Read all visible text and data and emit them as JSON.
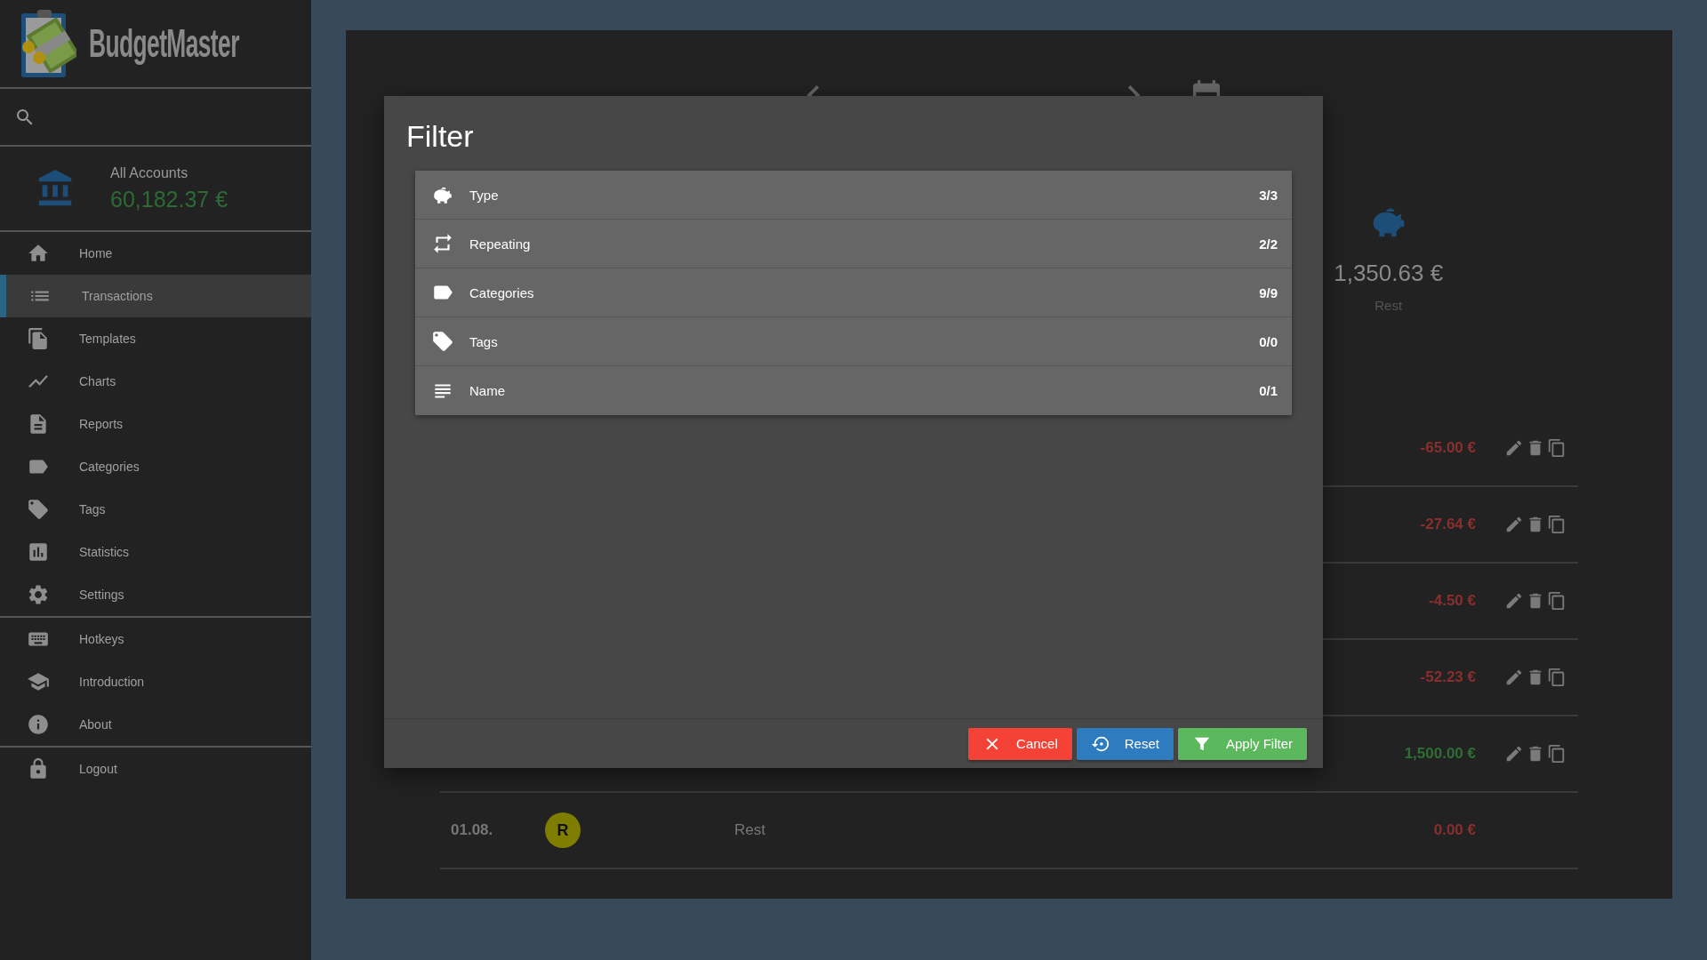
{
  "sidebar": {
    "app_name": "BudgetMaster",
    "account": {
      "name": "All Accounts",
      "balance": "60,182.37 €"
    },
    "groups": [
      {
        "items": [
          {
            "label": "Home",
            "selected": false
          },
          {
            "label": "Transactions",
            "selected": true
          },
          {
            "label": "Templates",
            "selected": false
          },
          {
            "label": "Charts",
            "selected": false
          },
          {
            "label": "Reports",
            "selected": false
          },
          {
            "label": "Categories",
            "selected": false
          },
          {
            "label": "Tags",
            "selected": false
          },
          {
            "label": "Statistics",
            "selected": false
          },
          {
            "label": "Settings",
            "selected": false
          }
        ]
      },
      {
        "items": [
          {
            "label": "Hotkeys",
            "selected": false
          },
          {
            "label": "Introduction",
            "selected": false
          },
          {
            "label": "About",
            "selected": false
          }
        ]
      },
      {
        "items": [
          {
            "label": "Logout",
            "selected": false
          }
        ]
      }
    ]
  },
  "summary": {
    "amount": "1,350.63 €",
    "label": "Rest"
  },
  "transactions": [
    {
      "amount": "-65.00 €",
      "kind": "expense",
      "actions": true
    },
    {
      "amount": "-27.64 €",
      "kind": "expense",
      "actions": true
    },
    {
      "amount": "-4.50 €",
      "kind": "expense",
      "actions": true
    },
    {
      "amount": "-52.23 €",
      "kind": "expense",
      "actions": true
    },
    {
      "amount": "1,500.00 €",
      "kind": "income",
      "actions": true
    },
    {
      "date": "01.08.",
      "circle_letter": "R",
      "color": "#7f7d00",
      "name": "Rest",
      "amount": "0.00 €",
      "kind": "expense",
      "actions": false
    }
  ],
  "dialog": {
    "title": "Filter",
    "filters": [
      {
        "label": "Type",
        "count": "3/3"
      },
      {
        "label": "Repeating",
        "count": "2/2"
      },
      {
        "label": "Categories",
        "count": "9/9"
      },
      {
        "label": "Tags",
        "count": "0/0"
      },
      {
        "label": "Name",
        "count": "0/1"
      }
    ],
    "buttons": [
      {
        "label": "Cancel",
        "kind": "cancel"
      },
      {
        "label": "Reset",
        "kind": "reset"
      },
      {
        "label": "Apply Filter",
        "kind": "apply"
      }
    ]
  }
}
